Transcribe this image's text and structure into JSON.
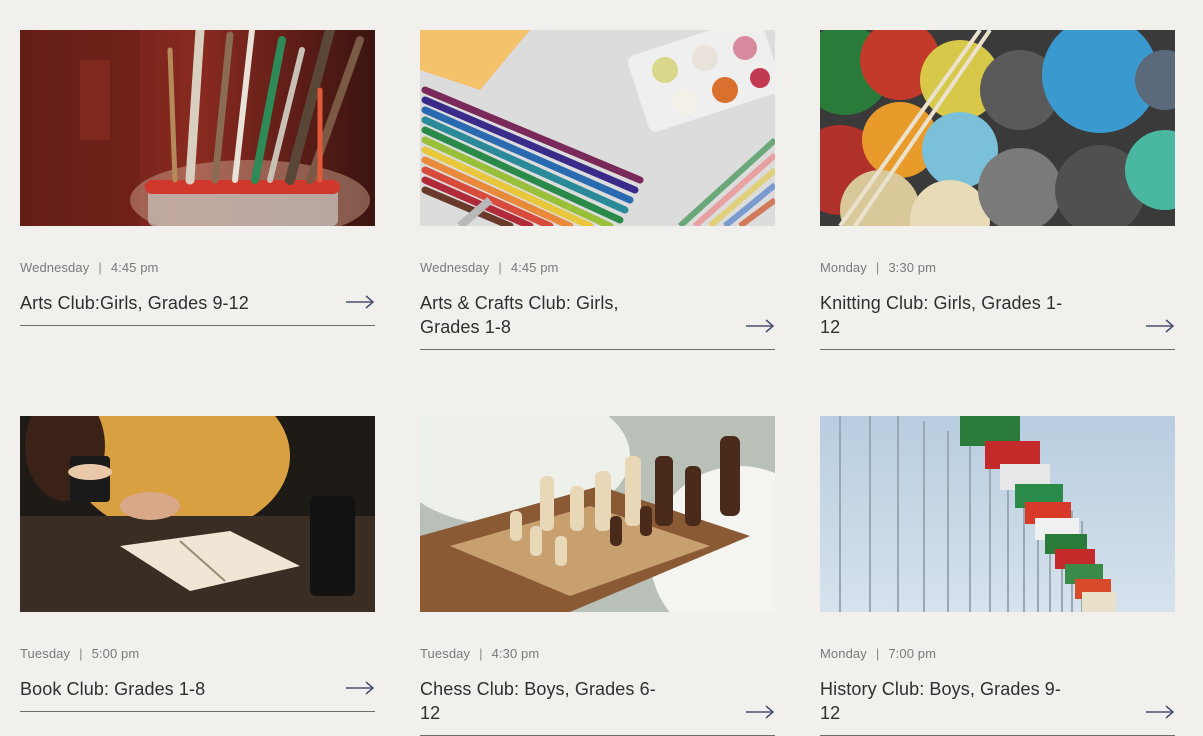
{
  "clubs": [
    {
      "day": "Wednesday",
      "sep": "|",
      "time": "4:45 pm",
      "title": "Arts Club:Girls, Grades 9-12",
      "image": "paintbrushes-jar"
    },
    {
      "day": "Wednesday",
      "sep": "|",
      "time": "4:45 pm",
      "title": "Arts & Crafts Club: Girls, Grades 1-8",
      "image": "colored-pencils-paints"
    },
    {
      "day": "Monday",
      "sep": "|",
      "time": "3:30 pm",
      "title": "Knitting Club: Girls, Grades 1-12",
      "image": "yarn-balls"
    },
    {
      "day": "Tuesday",
      "sep": "|",
      "time": "5:00 pm",
      "title": "Book Club: Grades 1-8",
      "image": "reading-book-coffee"
    },
    {
      "day": "Tuesday",
      "sep": "|",
      "time": "4:30 pm",
      "title": "Chess Club: Boys, Grades 6-12",
      "image": "chess-board"
    },
    {
      "day": "Monday",
      "sep": "|",
      "time": "7:00 pm",
      "title": "History Club: Boys, Grades 9-12",
      "image": "flags-poles"
    }
  ],
  "colors": {
    "background": "#f1f0ed",
    "text": "#2f2f2f",
    "meta": "#7a7a7a",
    "arrow": "#4a4f6e"
  }
}
